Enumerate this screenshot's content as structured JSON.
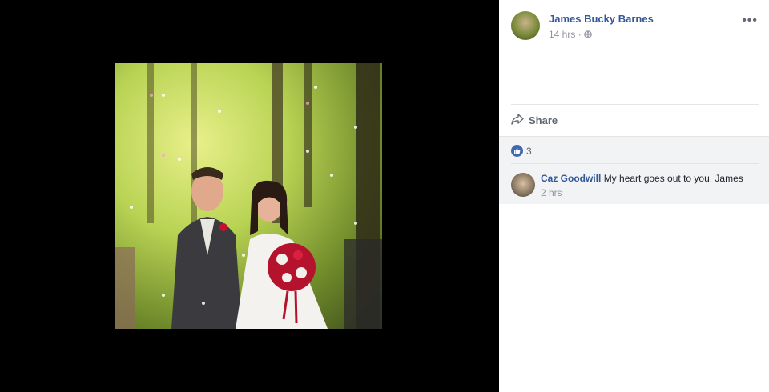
{
  "post": {
    "author": "James Bucky Barnes",
    "time": "14 hrs",
    "separator": "·",
    "audience_icon": "globe-icon",
    "more_icon": "ellipsis-icon"
  },
  "actions": {
    "share_label": "Share",
    "share_icon": "share-arrow-icon"
  },
  "reactions": {
    "like_icon": "like-thumb-icon",
    "count": "3"
  },
  "comments": [
    {
      "name": "Caz Goodwill",
      "text": "My heart goes out to you, James",
      "time": "2 hrs"
    }
  ],
  "colors": {
    "link": "#365899",
    "meta": "#90949c",
    "like": "#4267b2",
    "feedback_bg": "#f2f3f5"
  }
}
